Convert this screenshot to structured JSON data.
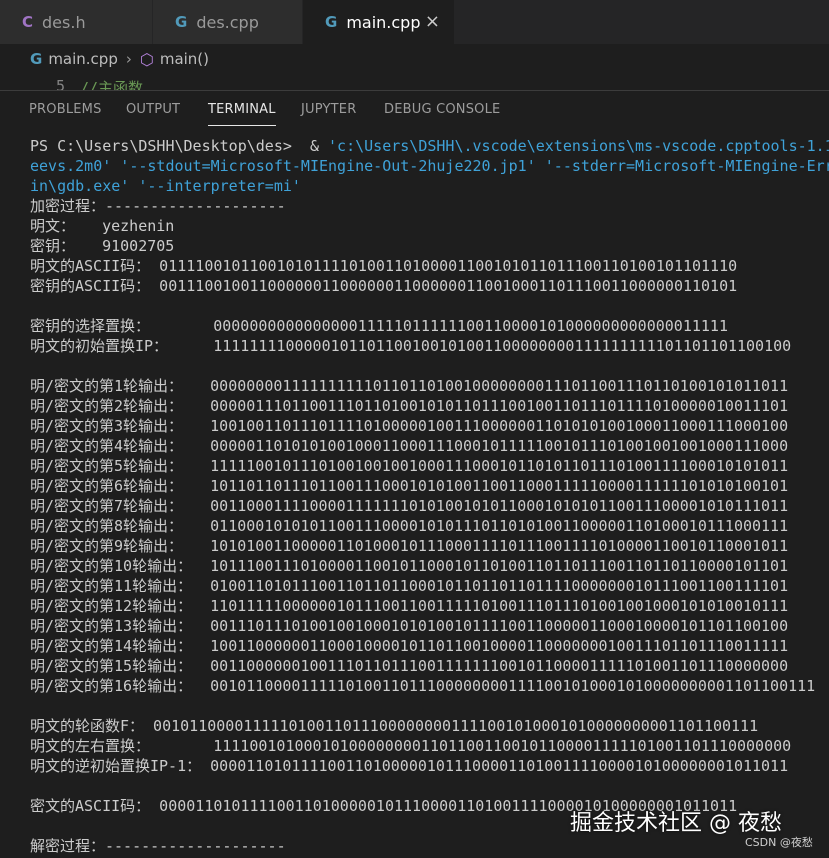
{
  "tabs": [
    {
      "icon": "C",
      "label": "des.h"
    },
    {
      "icon": "G",
      "label": "des.cpp"
    },
    {
      "icon": "G",
      "label": "main.cpp",
      "close": "×"
    }
  ],
  "breadcrumb": {
    "file": "main.cpp",
    "separator": "›",
    "symbol": "main()"
  },
  "code_peek": {
    "line_number": "5",
    "comment": "//主函数"
  },
  "panel_tabs": [
    "PROBLEMS",
    "OUTPUT",
    "TERMINAL",
    "JUPYTER",
    "DEBUG CONSOLE"
  ],
  "terminal": {
    "prompt": "PS C:\\Users\\DSHH\\Desktop\\des>  & ",
    "cmd_path": "'c:\\Users\\DSHH\\.vscode\\extensions\\ms-vscode.cpptools-1.1",
    "cmd_line2": "eevs.2m0' '--stdout=Microsoft-MIEngine-Out-2huje220.jp1' '--stderr=Microsoft-MIEngine-Err",
    "cmd_line3": "in\\gdb.exe' '--interpreter=mi'",
    "lines": [
      "加密过程：--------------------",
      "明文：   yezhenin",
      "密钥：   91002705",
      "明文的ASCII码： 0111100101100101011110100110100001100101011011100110100101101110",
      "密钥的ASCII码： 0011100100110000001100000011000000110010001101110011000000110101",
      "",
      "密钥的选择置换：       000000000000000011111011111100110000101000000000000011111",
      "明文的初始置换IP：     1111111100000101101100100101001100000000111111111101101101100100",
      "",
      "明/密文的第1轮输出：   0000000011111111110110110100100000000111011001110110100101011011",
      "明/密文的第2轮输出：   0000011101100111011010010101101110010011011101111010000010011101",
      "明/密文的第3轮输出：   1001001101110111101000001001110000001101010100100011000111000100",
      "明/密文的第4轮输出：   0000011010101001000110001110001011111001011101001001001000111000",
      "明/密文的第5轮输出：   1111100101110100100100100011100010110101101110100111100010101011",
      "明/密文的第6轮输出：   1011011011101100111000101010011001100011111000011111101010100101",
      "明/密文的第7轮输出：   0011000111100001111111010100101011000101010110011100001010111011",
      "明/密文的第8轮输出：   0110001010101100111000010101110110101001100000110100010111000111",
      "明/密文的第9轮输出：   1010100110000011010001011100011110111001111010000110010110001011",
      "明/密文的第10轮输出：  1011100111010000110010110001011010011011011100110110110000101101",
      "明/密文的第11轮输出：  0100110101110011011011000101101101101111000000010111001100111101",
      "明/密文的第12轮输出：  1101111100000010111001100111110100111011101001001000101010010111",
      "明/密文的第13轮输出：  0011101110100100100010101001011110011000001100010000101101100100",
      "明/密文的第14轮输出：  1001100000011000100001011011001000011000000010011101101110011111",
      "明/密文的第15轮输出：  0011000000100111011011100111111100101100001111101001101110000000",
      "明/密文的第16轮输出：  0010110000111110100110111000000001111001010001010000000001101100111",
      "",
      "明文的轮函数F： 0010110000111110100110111000000001111001010001010000000001101100111",
      "明文的左右置换：       1111001010001010000000011011001100101100001111101001101110000000",
      "明文的逆初始置换IP-1： 0000110101111001101000001011100001101001111000010100000001011011",
      "",
      "密文的ASCII码： 0000110101111001101000001011100001101001111000010100000001011011",
      "",
      "解密过程：--------------------"
    ]
  },
  "watermark": {
    "text": "掘金技术社区 @ 夜愁",
    "csdn": "CSDN @夜愁"
  }
}
